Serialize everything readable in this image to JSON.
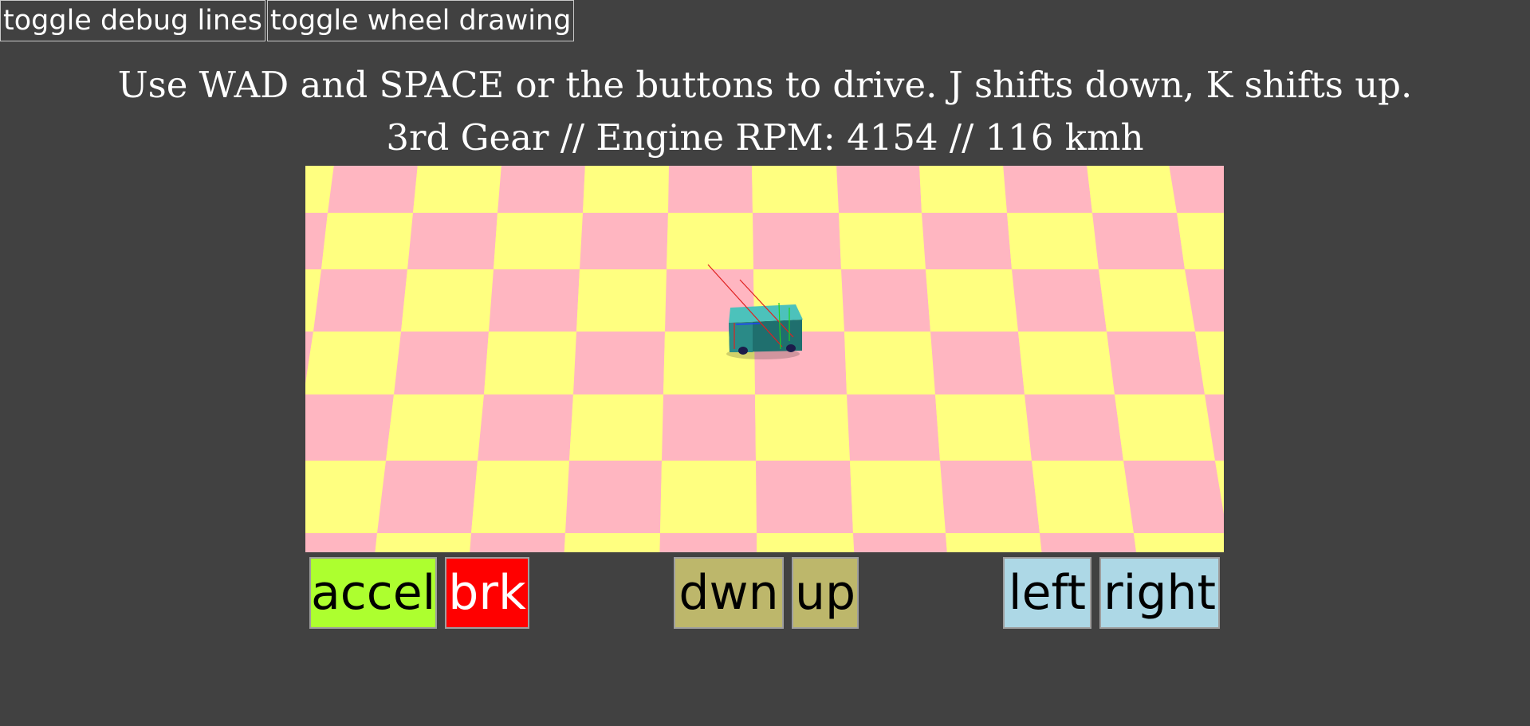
{
  "toolbar": {
    "debug_label": "toggle debug lines",
    "wheel_label": "toggle wheel drawing"
  },
  "instructions": "Use WAD and SPACE or the buttons to drive. J shifts down, K shifts up.",
  "status": "3rd Gear // Engine RPM: 4154 // 116 kmh",
  "controls": {
    "accel": "accel",
    "brake": "brk",
    "down": "dwn",
    "up": "up",
    "left": "left",
    "right": "right"
  },
  "colors": {
    "background": "#414141",
    "floor_tile_a": "#ffff80",
    "floor_tile_b": "#ffb6c1",
    "accel_button": "#adff2f",
    "brake_button": "#ff0000",
    "shift_buttons": "#bdb76b",
    "steer_buttons": "#add8e6",
    "car_body": "#3aa6a0"
  }
}
